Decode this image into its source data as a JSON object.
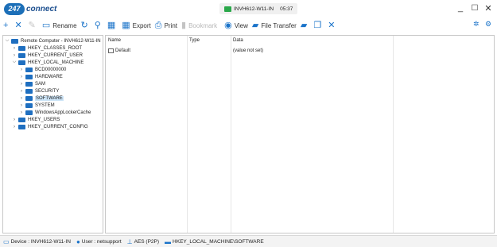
{
  "app": {
    "logo_badge": "247",
    "logo_text": "connect"
  },
  "session": {
    "computer": "INVH612-W11-IN",
    "time": "05:37"
  },
  "window_controls": {
    "minimize": "_",
    "maximize": "☐",
    "close": "✕"
  },
  "toolbar": {
    "rename": "Rename",
    "export": "Export",
    "print": "Print",
    "bookmark": "Bookmark",
    "view": "View",
    "file_transfer": "File Transfer"
  },
  "tree": {
    "root": "Remote Computer - INVH612-W11-IN",
    "hkcr": "HKEY_CLASSES_ROOT",
    "hkcu": "HKEY_CURRENT_USER",
    "hklm": "HKEY_LOCAL_MACHINE",
    "hklm_children": [
      "BCD00000000",
      "HARDWARE",
      "SAM",
      "SECURITY",
      "SOFTWARE",
      "SYSTEM",
      "WindowsAppLockerCache"
    ],
    "hku": "HKEY_USERS",
    "hkcc": "HKEY_CURRENT_CONFIG"
  },
  "list": {
    "headers": {
      "name": "Name",
      "type": "Type",
      "data": "Data"
    },
    "rows": [
      {
        "name": "Default",
        "type": "",
        "data": "(value not set)"
      }
    ]
  },
  "status": {
    "device": "Device : INVH612-W11-IN",
    "user": "User : netsupport",
    "encryption": "AES (P2P)",
    "path": "HKEY_LOCAL_MACHINE\\SOFTWARE"
  },
  "colors": {
    "accent": "#1a73c9",
    "folder": "#1f6fc0",
    "selection": "#cce4f7",
    "online": "#2aa84a"
  }
}
